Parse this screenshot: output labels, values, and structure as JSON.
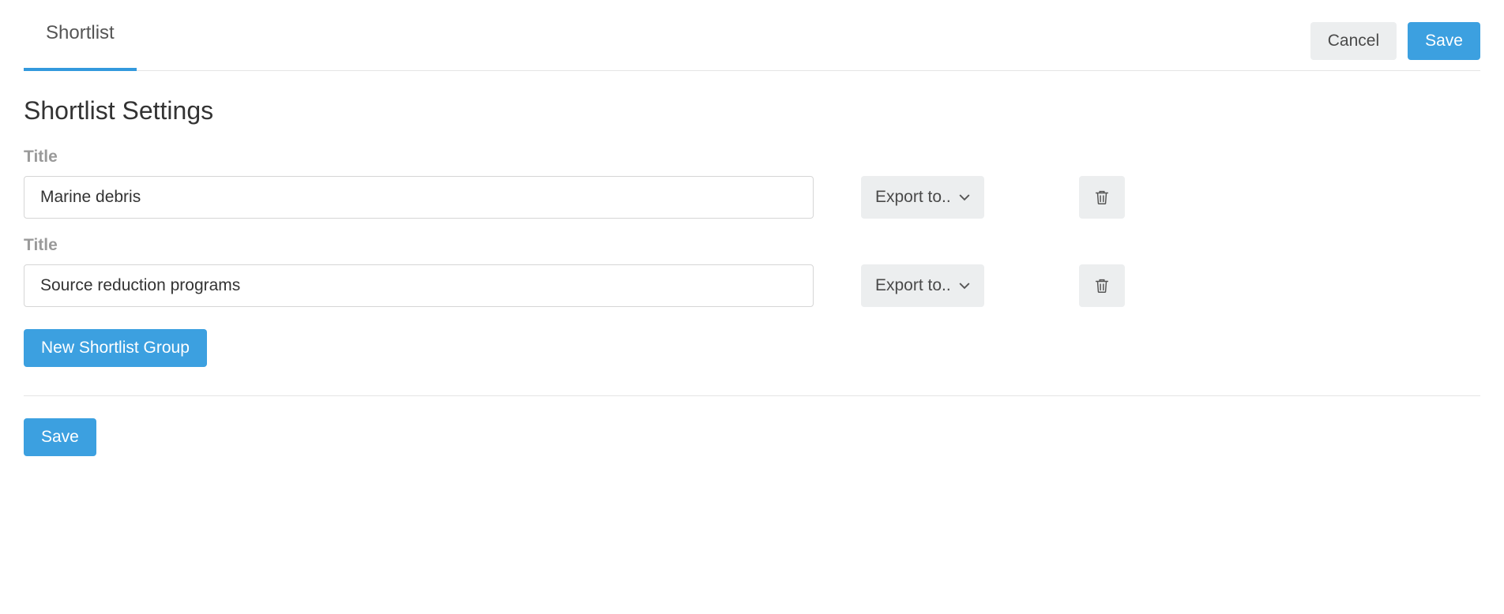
{
  "tabs": {
    "shortlist": "Shortlist"
  },
  "actions": {
    "cancel": "Cancel",
    "save_top": "Save",
    "save_bottom": "Save"
  },
  "page": {
    "heading": "Shortlist Settings"
  },
  "labels": {
    "title": "Title"
  },
  "groups": [
    {
      "title_value": "Marine debris",
      "export_label": "Export to.."
    },
    {
      "title_value": "Source reduction programs",
      "export_label": "Export to.."
    }
  ],
  "buttons": {
    "new_group": "New Shortlist Group"
  }
}
